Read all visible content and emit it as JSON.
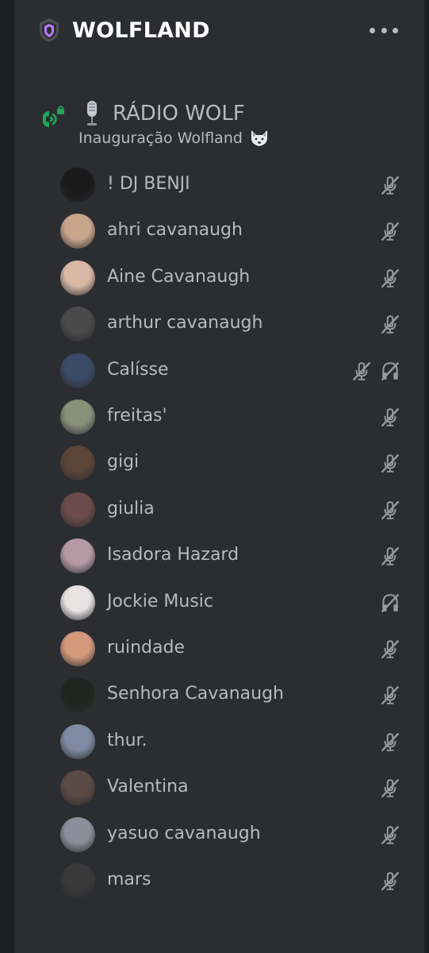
{
  "server": {
    "name": "WOLFLAND",
    "icon": "server-shield-icon",
    "menu_icon": "more-horizontal-icon"
  },
  "channel": {
    "name": "RÁDIO WOLF",
    "status": "Inauguração Wolfland",
    "icon": "voice-connected-icon",
    "name_emoji": "microphone",
    "status_emoji": "wolf"
  },
  "colors": {
    "background": "#1e1f22",
    "panel": "#2b2d31",
    "text_muted": "#b5bac1",
    "connected_green": "#23a55a",
    "brand_purple": "#b87cf6"
  },
  "members": [
    {
      "name": "! DJ BENJI",
      "muted": true,
      "deafened": false,
      "avatar_color": "#1a1a1a"
    },
    {
      "name": "ahri cavanaugh",
      "muted": true,
      "deafened": false,
      "avatar_color": "#c9a68a"
    },
    {
      "name": "Aine Cavanaugh",
      "muted": true,
      "deafened": false,
      "avatar_color": "#d9b8a6"
    },
    {
      "name": "arthur cavanaugh",
      "muted": true,
      "deafened": false,
      "avatar_color": "#4a4a4a"
    },
    {
      "name": "Calísse",
      "muted": true,
      "deafened": true,
      "avatar_color": "#3b4a66"
    },
    {
      "name": "freitas'",
      "muted": true,
      "deafened": false,
      "avatar_color": "#8a8f7a"
    },
    {
      "name": "gigi",
      "muted": true,
      "deafened": false,
      "avatar_color": "#5b4638"
    },
    {
      "name": "giulia",
      "muted": true,
      "deafened": false,
      "avatar_color": "#6b4b4b"
    },
    {
      "name": "Isadora Hazard",
      "muted": true,
      "deafened": false,
      "avatar_color": "#b59aa4"
    },
    {
      "name": "Jockie Music",
      "muted": false,
      "deafened": true,
      "avatar_color": "#e8e2e2"
    },
    {
      "name": "ruindade",
      "muted": true,
      "deafened": false,
      "avatar_color": "#d39a7c"
    },
    {
      "name": "Senhora Cavanaugh",
      "muted": true,
      "deafened": false,
      "avatar_color": "#1f2620"
    },
    {
      "name": "thur.",
      "muted": true,
      "deafened": false,
      "avatar_color": "#7f8aa3"
    },
    {
      "name": "Valentina",
      "muted": true,
      "deafened": false,
      "avatar_color": "#5c4a45"
    },
    {
      "name": "yasuo cavanaugh",
      "muted": true,
      "deafened": false,
      "avatar_color": "#8b8f99"
    },
    {
      "name": "mars",
      "muted": true,
      "deafened": false,
      "avatar_color": "#3a3a3a"
    }
  ]
}
